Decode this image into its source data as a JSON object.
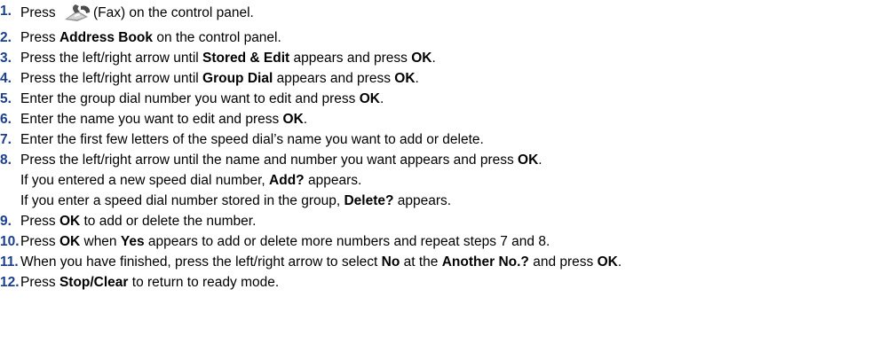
{
  "steps": [
    {
      "num": "1.",
      "parts": [
        "Press ",
        "",
        "(Fax) on the control panel."
      ]
    },
    {
      "num": "2.",
      "parts": [
        "Press ",
        "Address Book",
        " on the control panel."
      ]
    },
    {
      "num": "3.",
      "parts": [
        "Press the left/right arrow until ",
        "Stored & Edit",
        " appears and press ",
        "OK",
        "."
      ]
    },
    {
      "num": "4.",
      "parts": [
        "Press the left/right arrow until ",
        "Group Dial",
        " appears and press ",
        "OK",
        "."
      ]
    },
    {
      "num": "5.",
      "parts": [
        "Enter the group dial number you want to edit and press ",
        "OK",
        "."
      ]
    },
    {
      "num": "6.",
      "parts": [
        "Enter the name you want to edit and press ",
        "OK",
        "."
      ]
    },
    {
      "num": "7.",
      "parts": [
        "Enter the first few letters of the speed dial’s name you want to add or delete."
      ]
    },
    {
      "num": "8.",
      "parts": [
        "Press the left/right arrow until the name and number you want appears and press ",
        "OK",
        "."
      ]
    },
    {
      "sub": [
        "If you entered a new speed dial number, ",
        "Add?",
        " appears."
      ]
    },
    {
      "sub": [
        "If you enter a speed dial number stored in the group, ",
        "Delete?",
        " appears."
      ]
    },
    {
      "num": "9.",
      "parts": [
        "Press ",
        "OK",
        " to add or delete the number."
      ]
    },
    {
      "num": "10.",
      "parts": [
        "Press ",
        "OK",
        " when ",
        "Yes",
        " appears to add or delete more numbers and repeat steps 7 and 8."
      ]
    },
    {
      "num": "11.",
      "parts": [
        "When you have finished, press the left/right arrow to select ",
        "No",
        " at the ",
        "Another No.?",
        " and press ",
        "OK",
        "."
      ]
    },
    {
      "num": "12.",
      "parts": [
        "Press ",
        "Stop/Clear",
        " to return to ready mode."
      ]
    }
  ],
  "icons": {
    "fax": "fax-icon"
  },
  "colors": {
    "step_number": "#1b3f8c",
    "text": "#000000"
  }
}
